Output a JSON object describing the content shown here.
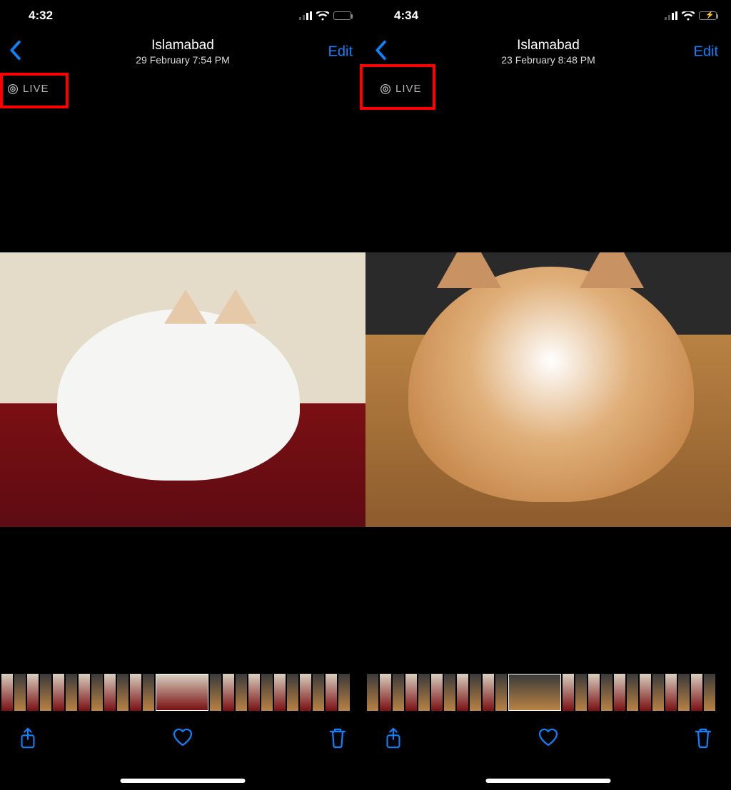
{
  "screens": [
    {
      "status": {
        "time": "4:32",
        "battery_style": "white",
        "charging": false
      },
      "header": {
        "location": "Islamabad",
        "datetime": "29 February  7:54 PM",
        "edit": "Edit"
      },
      "live_badge": "LIVE"
    },
    {
      "status": {
        "time": "4:34",
        "battery_style": "green",
        "charging": true
      },
      "header": {
        "location": "Islamabad",
        "datetime": "23 February  8:48 PM",
        "edit": "Edit"
      },
      "live_badge": "LIVE"
    }
  ],
  "colors": {
    "accent": "#0a84ff",
    "annotation": "#ff0000"
  }
}
